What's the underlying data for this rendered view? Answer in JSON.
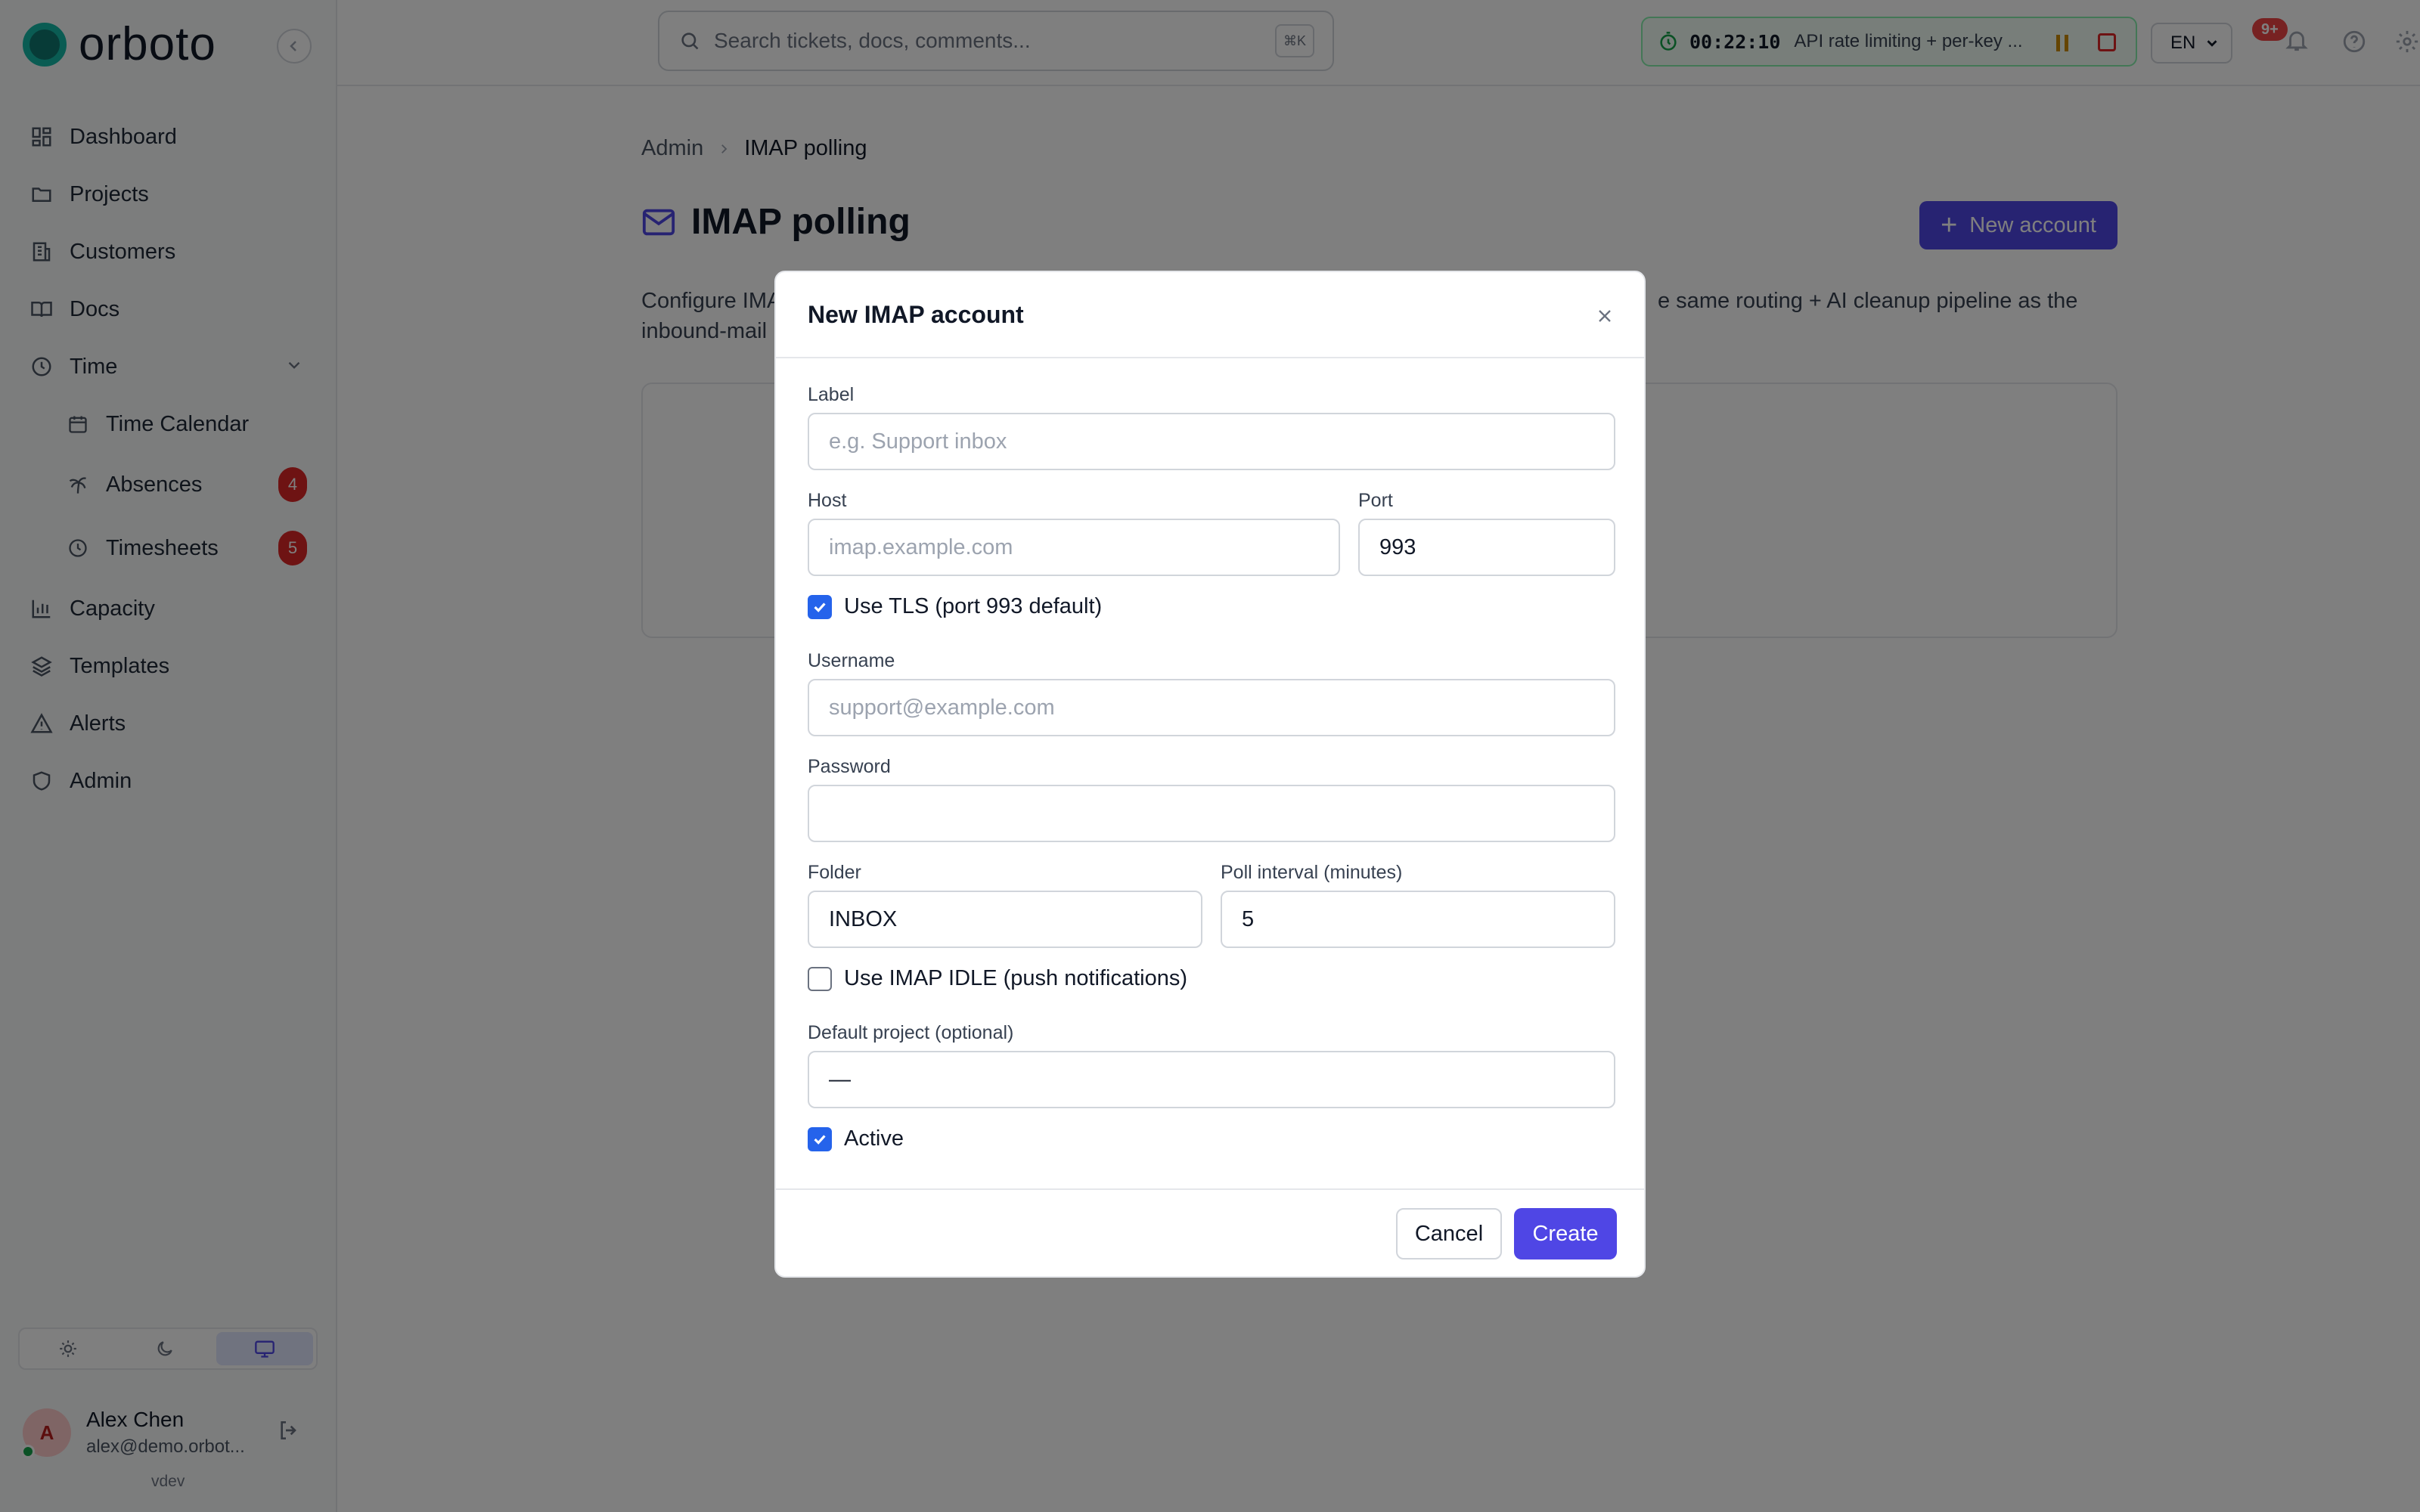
{
  "app": {
    "brand": "orboto"
  },
  "sidebar": {
    "items": [
      {
        "label": "Dashboard"
      },
      {
        "label": "Projects"
      },
      {
        "label": "Customers"
      },
      {
        "label": "Docs"
      },
      {
        "label": "Time"
      },
      {
        "label": "Time Calendar"
      },
      {
        "label": "Absences",
        "badge": "4"
      },
      {
        "label": "Timesheets",
        "badge": "5"
      },
      {
        "label": "Capacity"
      },
      {
        "label": "Templates"
      },
      {
        "label": "Alerts"
      },
      {
        "label": "Admin"
      }
    ],
    "user": {
      "initial": "A",
      "name": "Alex Chen",
      "email": "alex@demo.orbot..."
    },
    "version": "vdev"
  },
  "topbar": {
    "search_placeholder": "Search tickets, docs, comments...",
    "search_shortcut": "⌘K",
    "timer": {
      "time": "00:22:10",
      "task": "API rate limiting + per-key ..."
    },
    "language": "EN",
    "notifications_badge": "9+"
  },
  "page": {
    "breadcrumb": [
      "Admin",
      "IMAP polling"
    ],
    "title": "IMAP polling",
    "new_button": "New account",
    "description_left": "Configure IMA",
    "description_right": "e same routing + AI cleanup pipeline as the",
    "description_line2": "inbound-mail"
  },
  "modal": {
    "title": "New IMAP account",
    "label": {
      "label": "Label",
      "placeholder": "e.g. Support inbox",
      "value": ""
    },
    "host": {
      "label": "Host",
      "placeholder": "imap.example.com",
      "value": ""
    },
    "port": {
      "label": "Port",
      "value": "993"
    },
    "tls": {
      "label": "Use TLS (port 993 default)",
      "checked": true
    },
    "username": {
      "label": "Username",
      "placeholder": "support@example.com",
      "value": ""
    },
    "password": {
      "label": "Password",
      "value": ""
    },
    "folder": {
      "label": "Folder",
      "value": "INBOX"
    },
    "poll_interval": {
      "label": "Poll interval (minutes)",
      "value": "5"
    },
    "idle": {
      "label": "Use IMAP IDLE (push notifications)",
      "checked": false
    },
    "default_project": {
      "label": "Default project (optional)",
      "value": "—"
    },
    "active": {
      "label": "Active",
      "checked": true
    },
    "cancel": "Cancel",
    "create": "Create"
  },
  "colors": {
    "accent": "#4f46e5",
    "checkbox": "#2563eb",
    "badge": "#dc2626",
    "brand": "#14b8a6"
  }
}
